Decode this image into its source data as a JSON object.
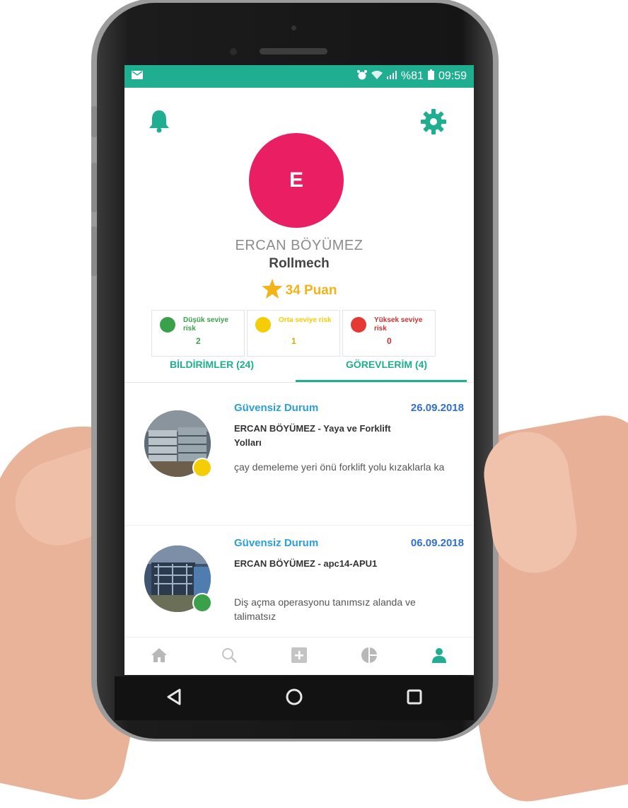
{
  "status_bar": {
    "battery": "%81",
    "time": "09:59"
  },
  "profile": {
    "avatar_letter": "E",
    "name": "ERCAN BÖYÜMEZ",
    "company": "Rollmech",
    "points": "34 Puan"
  },
  "risks": [
    {
      "label": "Düşük seviye risk",
      "count": "2",
      "color": "#3aa14a"
    },
    {
      "label": "Orta seviye risk",
      "count": "1",
      "color": "#f5cd06"
    },
    {
      "label": "Yüksek seviye risk",
      "count": "0",
      "color": "#e53935"
    }
  ],
  "tabs": [
    {
      "label": "BİLDİRİMLER (24)"
    },
    {
      "label": "GÖREVLERİM (4)"
    }
  ],
  "items": [
    {
      "type": "Güvensiz Durum",
      "date": "26.09.2018",
      "title": "ERCAN BÖYÜMEZ - Yaya ve Forklift Yolları",
      "description": "çay demeleme yeri önü forklift yolu kızaklarla ka",
      "risk_color": "#f5cd06"
    },
    {
      "type": "Güvensiz Durum",
      "date": "06.09.2018",
      "title": "ERCAN BÖYÜMEZ - apc14-APU1",
      "description": "Diş açma operasyonu tanımsız alanda ve talimatsız",
      "risk_color": "#3aa14a"
    }
  ],
  "bottom_nav": [
    "home-icon",
    "search-icon",
    "add-icon",
    "chart-icon",
    "profile-icon"
  ],
  "colors": {
    "accent": "#1fae8f",
    "avatar": "#e91e63",
    "points": "#f2b418",
    "item_type": "#2a9fd8",
    "item_date": "#2f6fd1"
  }
}
